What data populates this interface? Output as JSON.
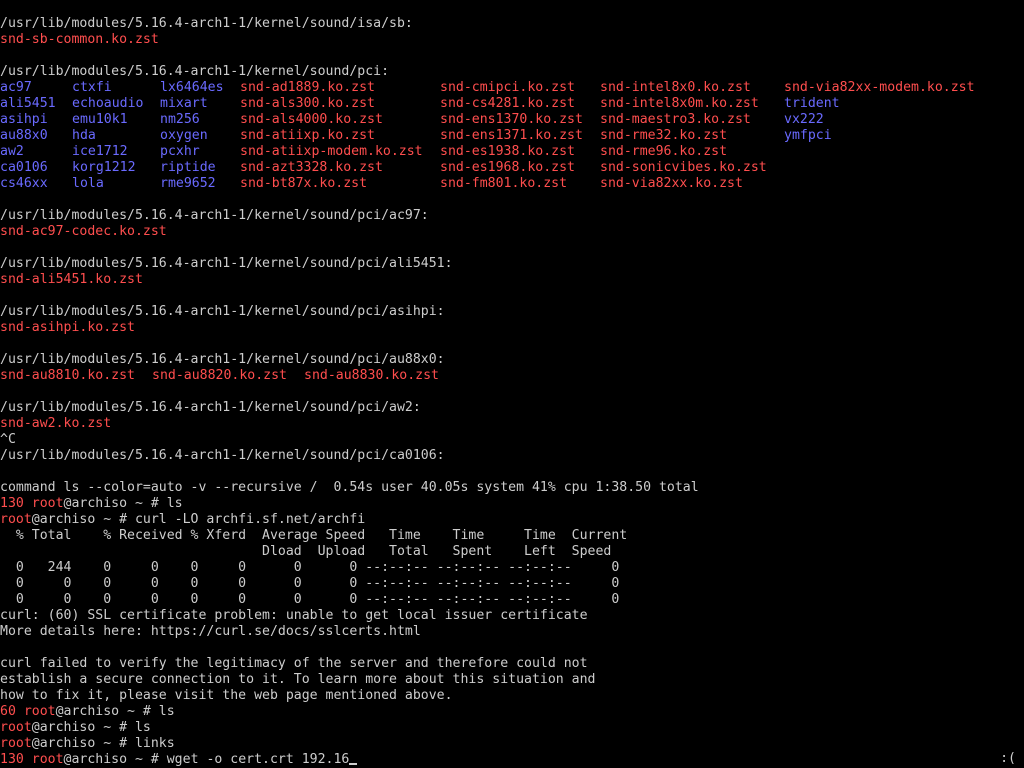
{
  "colors": {
    "background": "#000000",
    "text": "#cdcdcd",
    "red": "#ff4e4e",
    "blue": "#6a6aff"
  },
  "terminal": {
    "status_indicator": ":(",
    "lines": [
      {
        "segments": [
          {
            "t": "/usr/lib/modules/5.16.4-arch1-1/kernel/sound/isa/sb:",
            "c": "w"
          }
        ]
      },
      {
        "segments": [
          {
            "t": "snd-sb-common.ko.zst",
            "c": "r"
          }
        ]
      },
      {
        "segments": []
      },
      {
        "segments": [
          {
            "t": "/usr/lib/modules/5.16.4-arch1-1/kernel/sound/pci:",
            "c": "w"
          }
        ]
      },
      {
        "segments": [
          {
            "t": "ac97",
            "c": "b",
            "col": 0
          },
          {
            "t": "ctxfi",
            "c": "b",
            "col": 9
          },
          {
            "t": "lx6464es",
            "c": "b",
            "col": 20
          },
          {
            "t": "snd-ad1889.ko.zst",
            "c": "r",
            "col": 30
          },
          {
            "t": "snd-cmipci.ko.zst",
            "c": "r",
            "col": 55
          },
          {
            "t": "snd-intel8x0.ko.zst",
            "c": "r",
            "col": 75
          },
          {
            "t": "snd-via82xx-modem.ko.zst",
            "c": "r",
            "col": 98
          }
        ]
      },
      {
        "segments": [
          {
            "t": "ali5451",
            "c": "b",
            "col": 0
          },
          {
            "t": "echoaudio",
            "c": "b",
            "col": 9
          },
          {
            "t": "mixart",
            "c": "b",
            "col": 20
          },
          {
            "t": "snd-als300.ko.zst",
            "c": "r",
            "col": 30
          },
          {
            "t": "snd-cs4281.ko.zst",
            "c": "r",
            "col": 55
          },
          {
            "t": "snd-intel8x0m.ko.zst",
            "c": "r",
            "col": 75
          },
          {
            "t": "trident",
            "c": "b",
            "col": 98
          }
        ]
      },
      {
        "segments": [
          {
            "t": "asihpi",
            "c": "b",
            "col": 0
          },
          {
            "t": "emu10k1",
            "c": "b",
            "col": 9
          },
          {
            "t": "nm256",
            "c": "b",
            "col": 20
          },
          {
            "t": "snd-als4000.ko.zst",
            "c": "r",
            "col": 30
          },
          {
            "t": "snd-ens1370.ko.zst",
            "c": "r",
            "col": 55
          },
          {
            "t": "snd-maestro3.ko.zst",
            "c": "r",
            "col": 75
          },
          {
            "t": "vx222",
            "c": "b",
            "col": 98
          }
        ]
      },
      {
        "segments": [
          {
            "t": "au88x0",
            "c": "b",
            "col": 0
          },
          {
            "t": "hda",
            "c": "b",
            "col": 9
          },
          {
            "t": "oxygen",
            "c": "b",
            "col": 20
          },
          {
            "t": "snd-atiixp.ko.zst",
            "c": "r",
            "col": 30
          },
          {
            "t": "snd-ens1371.ko.zst",
            "c": "r",
            "col": 55
          },
          {
            "t": "snd-rme32.ko.zst",
            "c": "r",
            "col": 75
          },
          {
            "t": "ymfpci",
            "c": "b",
            "col": 98
          }
        ]
      },
      {
        "segments": [
          {
            "t": "aw2",
            "c": "b",
            "col": 0
          },
          {
            "t": "ice1712",
            "c": "b",
            "col": 9
          },
          {
            "t": "pcxhr",
            "c": "b",
            "col": 20
          },
          {
            "t": "snd-atiixp-modem.ko.zst",
            "c": "r",
            "col": 30
          },
          {
            "t": "snd-es1938.ko.zst",
            "c": "r",
            "col": 55
          },
          {
            "t": "snd-rme96.ko.zst",
            "c": "r",
            "col": 75
          }
        ]
      },
      {
        "segments": [
          {
            "t": "ca0106",
            "c": "b",
            "col": 0
          },
          {
            "t": "korg1212",
            "c": "b",
            "col": 9
          },
          {
            "t": "riptide",
            "c": "b",
            "col": 20
          },
          {
            "t": "snd-azt3328.ko.zst",
            "c": "r",
            "col": 30
          },
          {
            "t": "snd-es1968.ko.zst",
            "c": "r",
            "col": 55
          },
          {
            "t": "snd-sonicvibes.ko.zst",
            "c": "r",
            "col": 75
          }
        ]
      },
      {
        "segments": [
          {
            "t": "cs46xx",
            "c": "b",
            "col": 0
          },
          {
            "t": "lola",
            "c": "b",
            "col": 9
          },
          {
            "t": "rme9652",
            "c": "b",
            "col": 20
          },
          {
            "t": "snd-bt87x.ko.zst",
            "c": "r",
            "col": 30
          },
          {
            "t": "snd-fm801.ko.zst",
            "c": "r",
            "col": 55
          },
          {
            "t": "snd-via82xx.ko.zst",
            "c": "r",
            "col": 75
          }
        ]
      },
      {
        "segments": []
      },
      {
        "segments": [
          {
            "t": "/usr/lib/modules/5.16.4-arch1-1/kernel/sound/pci/ac97:",
            "c": "w"
          }
        ]
      },
      {
        "segments": [
          {
            "t": "snd-ac97-codec.ko.zst",
            "c": "r"
          }
        ]
      },
      {
        "segments": []
      },
      {
        "segments": [
          {
            "t": "/usr/lib/modules/5.16.4-arch1-1/kernel/sound/pci/ali5451:",
            "c": "w"
          }
        ]
      },
      {
        "segments": [
          {
            "t": "snd-ali5451.ko.zst",
            "c": "r"
          }
        ]
      },
      {
        "segments": []
      },
      {
        "segments": [
          {
            "t": "/usr/lib/modules/5.16.4-arch1-1/kernel/sound/pci/asihpi:",
            "c": "w"
          }
        ]
      },
      {
        "segments": [
          {
            "t": "snd-asihpi.ko.zst",
            "c": "r"
          }
        ]
      },
      {
        "segments": []
      },
      {
        "segments": [
          {
            "t": "/usr/lib/modules/5.16.4-arch1-1/kernel/sound/pci/au88x0:",
            "c": "w"
          }
        ]
      },
      {
        "segments": [
          {
            "t": "snd-au8810.ko.zst",
            "c": "r",
            "col": 0
          },
          {
            "t": "snd-au8820.ko.zst",
            "c": "r",
            "col": 19
          },
          {
            "t": "snd-au8830.ko.zst",
            "c": "r",
            "col": 38
          }
        ]
      },
      {
        "segments": []
      },
      {
        "segments": [
          {
            "t": "/usr/lib/modules/5.16.4-arch1-1/kernel/sound/pci/aw2:",
            "c": "w"
          }
        ]
      },
      {
        "segments": [
          {
            "t": "snd-aw2.ko.zst",
            "c": "r"
          }
        ]
      },
      {
        "segments": [
          {
            "t": "^C",
            "c": "w"
          }
        ]
      },
      {
        "segments": [
          {
            "t": "/usr/lib/modules/5.16.4-arch1-1/kernel/sound/pci/ca0106:",
            "c": "w"
          }
        ]
      },
      {
        "segments": []
      },
      {
        "segments": [
          {
            "t": "command ls --color=auto -v --recursive /  0.54s user 40.05s system 41% cpu 1:38.50 total",
            "c": "w"
          }
        ]
      },
      {
        "segments": [
          {
            "t": "130 ",
            "c": "r"
          },
          {
            "t": "root",
            "c": "r"
          },
          {
            "t": "@archiso ~ # ls",
            "c": "w"
          }
        ]
      },
      {
        "segments": [
          {
            "t": "root",
            "c": "r"
          },
          {
            "t": "@archiso ~ # curl -LO archfi.sf.net/archfi",
            "c": "w"
          }
        ]
      },
      {
        "segments": [
          {
            "t": "  % Total    % Received % Xferd  Average Speed   Time    Time     Time  Current",
            "c": "w"
          }
        ]
      },
      {
        "segments": [
          {
            "t": "                                 Dload  Upload   Total   Spent    Left  Speed",
            "c": "w"
          }
        ]
      },
      {
        "segments": [
          {
            "t": "  0   244    0     0    0     0      0      0 --:--:-- --:--:-- --:--:--     0",
            "c": "w"
          }
        ]
      },
      {
        "segments": [
          {
            "t": "  0     0    0     0    0     0      0      0 --:--:-- --:--:-- --:--:--     0",
            "c": "w"
          }
        ]
      },
      {
        "segments": [
          {
            "t": "  0     0    0     0    0     0      0      0 --:--:-- --:--:-- --:--:--     0",
            "c": "w"
          }
        ]
      },
      {
        "segments": [
          {
            "t": "curl: (60) SSL certificate problem: unable to get local issuer certificate",
            "c": "w"
          }
        ]
      },
      {
        "segments": [
          {
            "t": "More details here: https://curl.se/docs/sslcerts.html",
            "c": "w"
          }
        ]
      },
      {
        "segments": []
      },
      {
        "segments": [
          {
            "t": "curl failed to verify the legitimacy of the server and therefore could not",
            "c": "w"
          }
        ]
      },
      {
        "segments": [
          {
            "t": "establish a secure connection to it. To learn more about this situation and",
            "c": "w"
          }
        ]
      },
      {
        "segments": [
          {
            "t": "how to fix it, please visit the web page mentioned above.",
            "c": "w"
          }
        ]
      },
      {
        "segments": [
          {
            "t": "60 ",
            "c": "r"
          },
          {
            "t": "root",
            "c": "r"
          },
          {
            "t": "@archiso ~ # ls",
            "c": "w"
          }
        ]
      },
      {
        "segments": [
          {
            "t": "root",
            "c": "r"
          },
          {
            "t": "@archiso ~ # ls",
            "c": "w"
          }
        ]
      },
      {
        "segments": [
          {
            "t": "root",
            "c": "r"
          },
          {
            "t": "@archiso ~ # links",
            "c": "w"
          }
        ]
      },
      {
        "segments": [
          {
            "t": "130 ",
            "c": "r"
          },
          {
            "t": "root",
            "c": "r"
          },
          {
            "t": "@archiso ~ # wget -o cert.crt 192.16",
            "c": "w"
          }
        ],
        "cursor": true
      }
    ]
  }
}
